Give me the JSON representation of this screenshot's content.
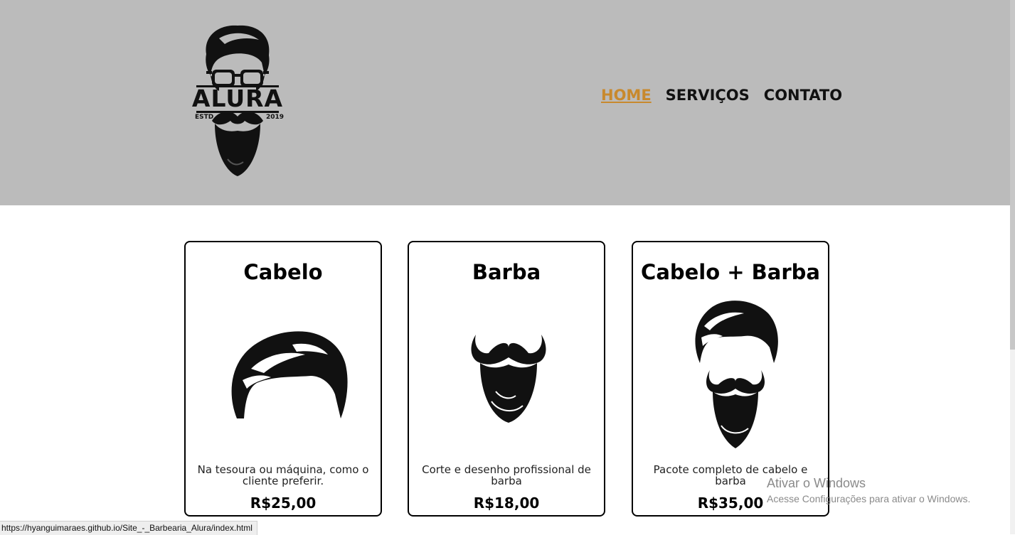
{
  "header": {
    "logo": {
      "brand": "ALURA",
      "estd": "ESTD",
      "year": "2019"
    },
    "nav": [
      {
        "label": "HOME",
        "active": true
      },
      {
        "label": "SERVIÇOS",
        "active": false
      },
      {
        "label": "CONTATO",
        "active": false
      }
    ],
    "accent_color": "#c8892d",
    "background_color": "#bbbbbb"
  },
  "cards": [
    {
      "title": "Cabelo",
      "icon": "hair-icon",
      "description": "Na tesoura ou máquina, como o cliente preferir.",
      "price": "R$25,00"
    },
    {
      "title": "Barba",
      "icon": "beard-icon",
      "description": "Corte e desenho profissional de barba",
      "price": "R$18,00"
    },
    {
      "title": "Cabelo + Barba",
      "icon": "hair-and-beard-icon",
      "description": "Pacote completo de cabelo e barba",
      "price": "R$35,00"
    }
  ],
  "watermark": {
    "line1": "Ativar o Windows",
    "line2": "Acesse Configurações para ativar o Windows."
  },
  "status_bar": {
    "url": "https://hyanguimaraes.github.io/Site_-_Barbearia_Alura/index.html"
  }
}
